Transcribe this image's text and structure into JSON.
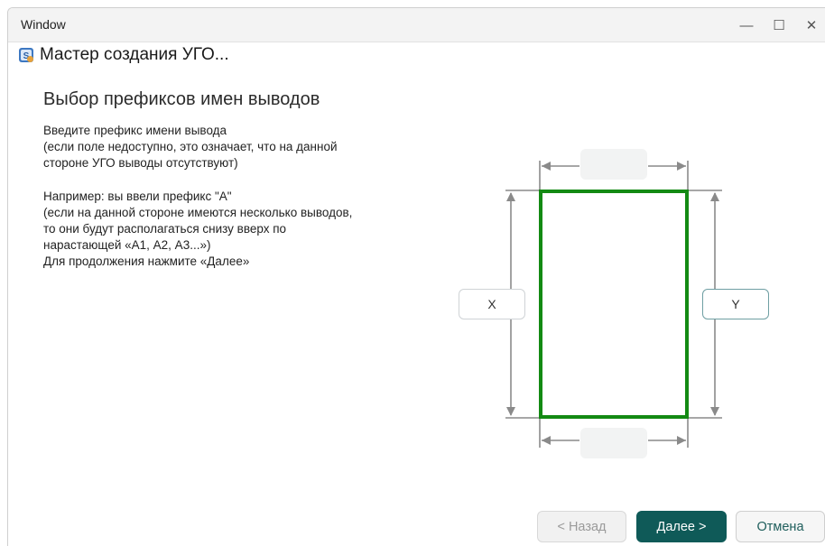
{
  "window": {
    "title": "Window",
    "minimize_glyph": "—",
    "maximize_glyph": "☐",
    "close_glyph": "✕"
  },
  "app": {
    "title": "Мастер создания УГО...",
    "icon": "wizard-app-icon"
  },
  "page": {
    "heading": "Выбор префиксов имен выводов",
    "intro_lines": [
      "Введите префикс имени вывода",
      "(если поле недоступно, это означает, что на данной",
      "стороне УГО выводы отсутствуют)"
    ],
    "example_lines": [
      "Например: вы ввели префикс \"А\"",
      "(если на данной стороне имеются несколько выводов,",
      "то они будут располагаться снизу вверх по",
      "нарастающей «А1, А2, А3...»)",
      "Для продолжения нажмите «Далее»"
    ]
  },
  "diagram": {
    "left_input": {
      "value": "X",
      "enabled": true
    },
    "right_input": {
      "value": "Y",
      "enabled": true
    },
    "top_input": {
      "value": "",
      "enabled": false
    },
    "bottom_input": {
      "value": "",
      "enabled": false
    },
    "frame_color": "#138a13",
    "guide_color": "#8a8a8a"
  },
  "buttons": {
    "back": "< Назад",
    "next": "Далее >",
    "cancel": "Отмена"
  },
  "colors": {
    "primary": "#0f5a58",
    "accent_border": "#6f9fa3"
  }
}
